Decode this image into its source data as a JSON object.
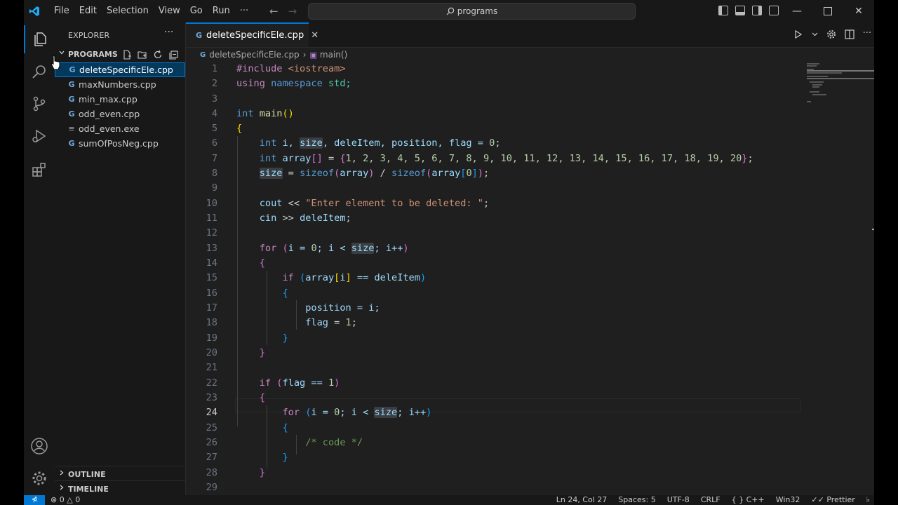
{
  "titlebar": {
    "menu": [
      "File",
      "Edit",
      "Selection",
      "View",
      "Go",
      "Run",
      "···"
    ],
    "search": "programs"
  },
  "sidebar": {
    "title": "EXPLORER",
    "section": "PROGRAMS",
    "files": [
      {
        "name": "deleteSpecificEle.cpp",
        "type": "cpp",
        "selected": true
      },
      {
        "name": "maxNumbers.cpp",
        "type": "cpp"
      },
      {
        "name": "min_max.cpp",
        "type": "cpp"
      },
      {
        "name": "odd_even.cpp",
        "type": "cpp"
      },
      {
        "name": "odd_even.exe",
        "type": "exe"
      },
      {
        "name": "sumOfPosNeg.cpp",
        "type": "cpp"
      }
    ],
    "outline": "OUTLINE",
    "timeline": "TIMELINE"
  },
  "editor": {
    "tab": "deleteSpecificEle.cpp",
    "breadcrumb": {
      "file": "deleteSpecificEle.cpp",
      "symbol": "main()"
    },
    "current_line": 24,
    "lines": [
      "1",
      "2",
      "3",
      "4",
      "5",
      "6",
      "7",
      "8",
      "9",
      "10",
      "11",
      "12",
      "13",
      "14",
      "15",
      "16",
      "17",
      "18",
      "19",
      "20",
      "21",
      "22",
      "23",
      "24",
      "25",
      "26",
      "27",
      "28",
      "29"
    ],
    "code": {
      "l1a": "#include",
      "l1b": " <iostream>",
      "l2a": "using",
      "l2b": " namespace",
      "l2c": " std;",
      "l4a": "int",
      "l4b": " main",
      "l4c": "()",
      "l5": "{",
      "l6a": "int",
      "l6b": " i, ",
      "l6c": "size",
      "l6d": ", deleItem, position, flag = ",
      "l6e": "0",
      "l6f": ";",
      "l7a": "int",
      "l7b": " array",
      "l7c": "[]",
      "l7d": " = ",
      "l7e": "{",
      "l7f": "1, 2, 3, 4, 5, 6, 7, 8, 9, 10, 11, 12, 13, 14, 15, 16, 17, 18, 19, 20",
      "l7g": "}",
      "l7h": ";",
      "l8a": "size",
      "l8b": " = ",
      "l8c": "sizeof",
      "l8d": "(",
      "l8e": "array",
      "l8f": ")",
      "l8g": " / ",
      "l8h": "sizeof",
      "l8i": "(",
      "l8j": "array",
      "l8k": "[",
      "l8l": "0",
      "l8m": "]",
      "l8n": ")",
      "l8o": ";",
      "l10a": "cout",
      "l10b": " << ",
      "l10c": "\"Enter element to be deleted: \"",
      "l10d": ";",
      "l11a": "cin",
      "l11b": " >> ",
      "l11c": "deleItem",
      "l11d": ";",
      "l13a": "for",
      "l13b": " (",
      "l13c": "i = ",
      "l13d": "0",
      "l13e": "; i < ",
      "l13f": "size",
      "l13g": "; i++",
      "l13h": ")",
      "l14": "{",
      "l15a": "if",
      "l15b": " (",
      "l15c": "array",
      "l15d": "[",
      "l15e": "i",
      "l15f": "]",
      "l15g": " == deleItem",
      "l15h": ")",
      "l16": "{",
      "l17a": "position",
      "l17b": " = i;",
      "l18a": "flag",
      "l18b": " = ",
      "l18c": "1",
      "l18d": ";",
      "l19": "}",
      "l20": "}",
      "l22a": "if",
      "l22b": " (",
      "l22c": "flag == ",
      "l22d": "1",
      "l22e": ")",
      "l23": "{",
      "l24a": "for",
      "l24b": " (",
      "l24c": "i = ",
      "l24d": "0",
      "l24e": "; i < ",
      "l24f": "size",
      "l24g": "; i++",
      "l24h": ")",
      "l25": "{",
      "l26": "/* code */",
      "l27": "}",
      "l28": "}"
    }
  },
  "statusbar": {
    "errors": "0",
    "warnings": "0",
    "position": "Ln 24, Col 27",
    "spaces": "Spaces: 5",
    "encoding": "UTF-8",
    "eol": "CRLF",
    "language": "C++",
    "platform": "Win32",
    "formatter": "Prettier"
  },
  "colors": {
    "accent": "#0078d4",
    "background": "#1f1f1f",
    "sidebar": "#181818"
  }
}
